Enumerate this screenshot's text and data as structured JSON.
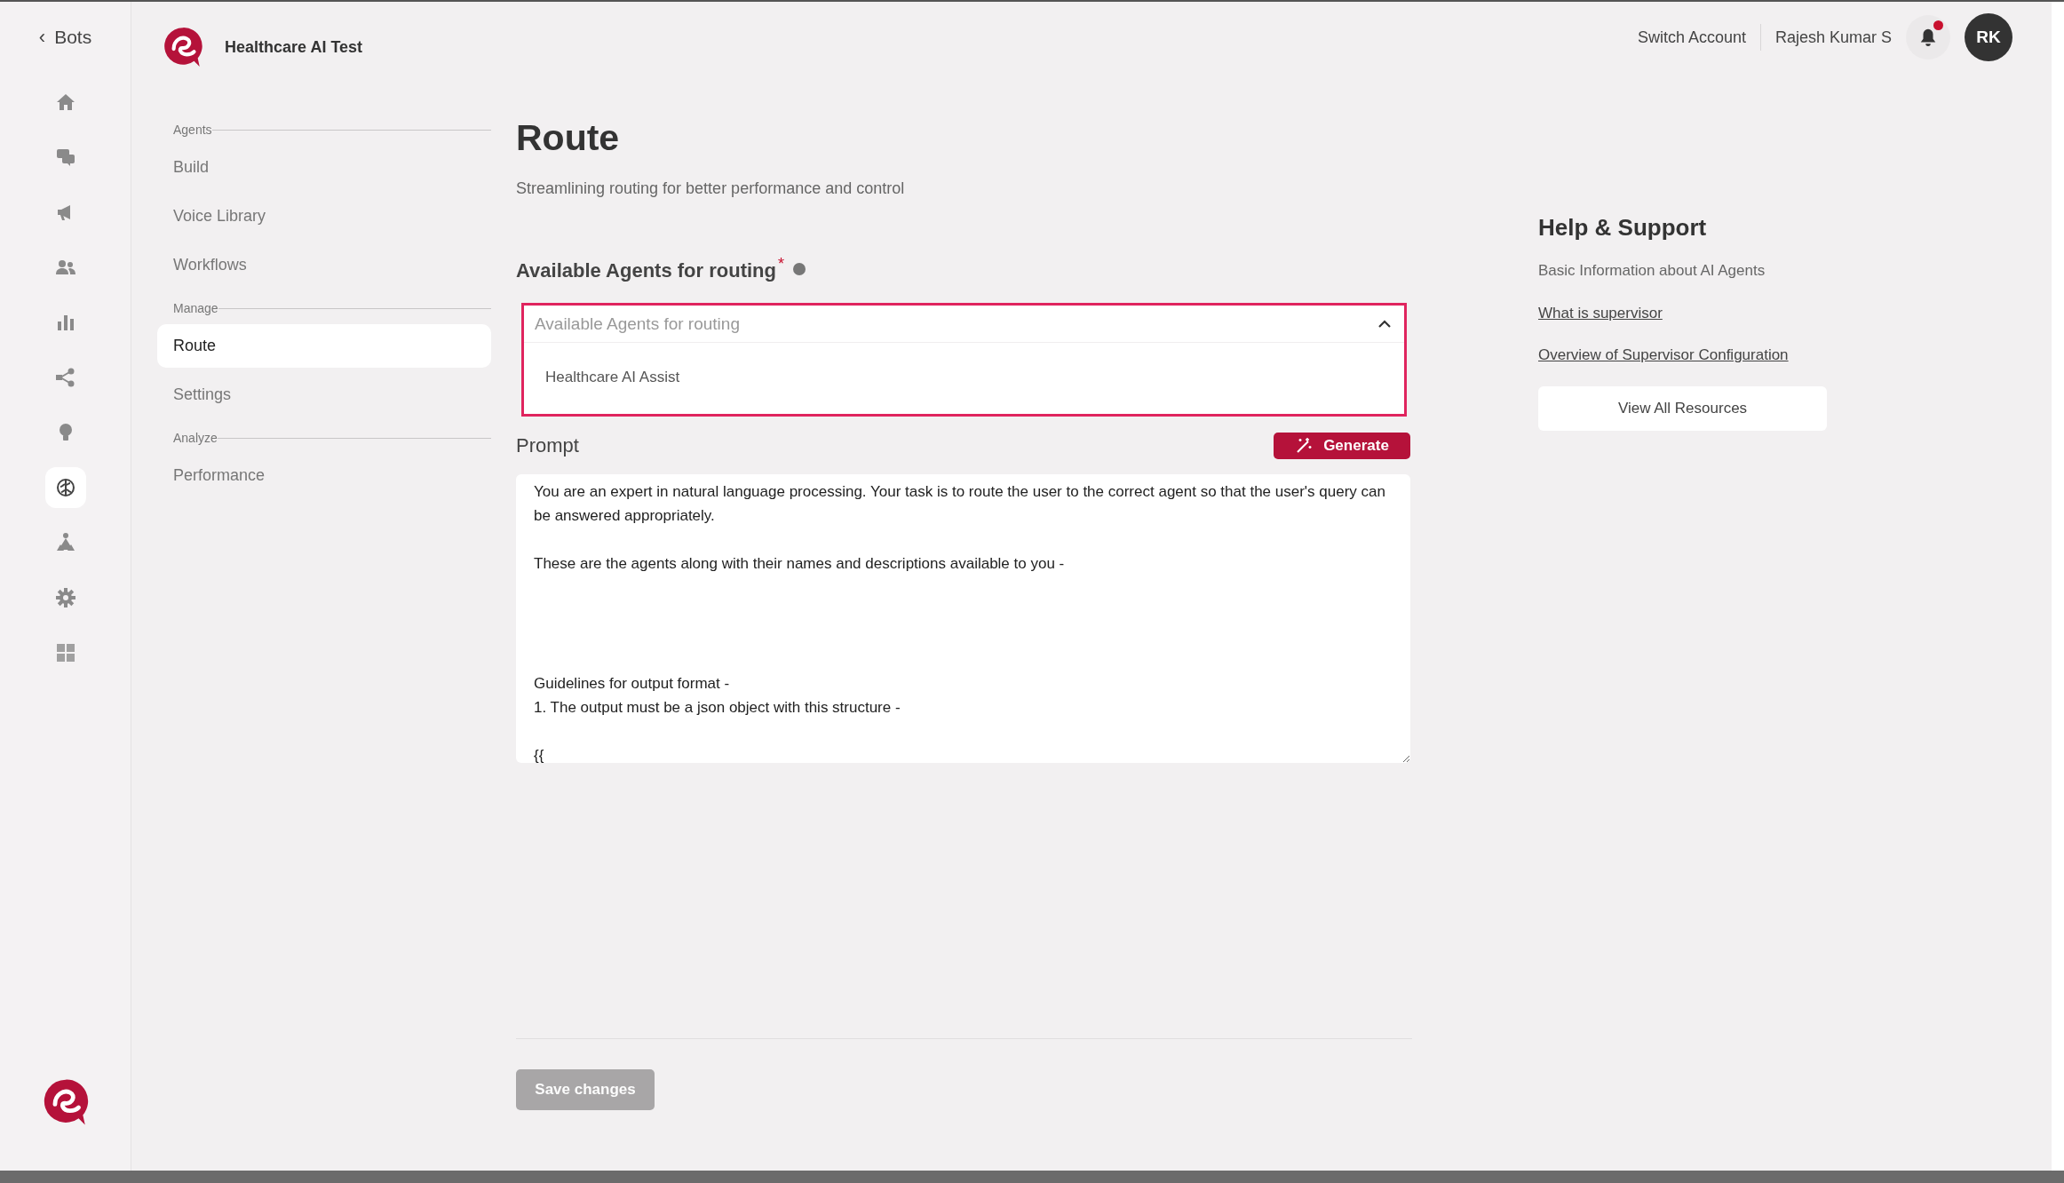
{
  "rail": {
    "back": {
      "icon": "‹",
      "label": "Bots"
    },
    "items": [
      {
        "selected": false
      },
      {
        "selected": false
      },
      {
        "selected": false
      },
      {
        "selected": false
      },
      {
        "selected": false
      },
      {
        "selected": false
      },
      {
        "selected": false
      },
      {
        "selected": true
      },
      {
        "selected": false
      },
      {
        "selected": false
      },
      {
        "selected": false
      }
    ]
  },
  "subnav": {
    "title": "Healthcare AI Test",
    "sections": [
      {
        "label": "Agents",
        "items": [
          {
            "label": "Build",
            "selected": false
          },
          {
            "label": "Voice Library",
            "selected": false
          },
          {
            "label": "Workflows",
            "selected": false
          }
        ]
      },
      {
        "label": "Manage",
        "items": [
          {
            "label": "Route",
            "selected": true
          },
          {
            "label": "Settings",
            "selected": false
          }
        ]
      },
      {
        "label": "Analyze",
        "items": [
          {
            "label": "Performance",
            "selected": false
          }
        ]
      }
    ]
  },
  "header": {
    "switch_account": "Switch Account",
    "user_name": "Rajesh Kumar S",
    "notification_unread": true,
    "avatar": "RK"
  },
  "page": {
    "title": "Route",
    "subtitle": "Streamlining routing for better performance and control"
  },
  "agents_field": {
    "label": "Available Agents for routing",
    "required_mark": "*",
    "placeholder": "Available Agents for routing",
    "expanded": true,
    "options": [
      "Healthcare AI Assist"
    ]
  },
  "prompt": {
    "label": "Prompt",
    "generate_button": "Generate",
    "value": "You are an expert in natural language processing. Your task is to route the user to the correct agent so that the user's query can be answered appropriately.\n\nThese are the agents along with their names and descriptions available to you -\n\n\n\n\nGuidelines for output format -\n1. The output must be a json object with this structure -\n\n{{"
  },
  "save_button": {
    "label": "Save changes",
    "disabled": true
  },
  "help": {
    "title": "Help & Support",
    "description": "Basic Information about AI Agents",
    "links": [
      "What is supervisor",
      "Overview of Supervisor Configuration"
    ],
    "button": "View All Resources"
  }
}
